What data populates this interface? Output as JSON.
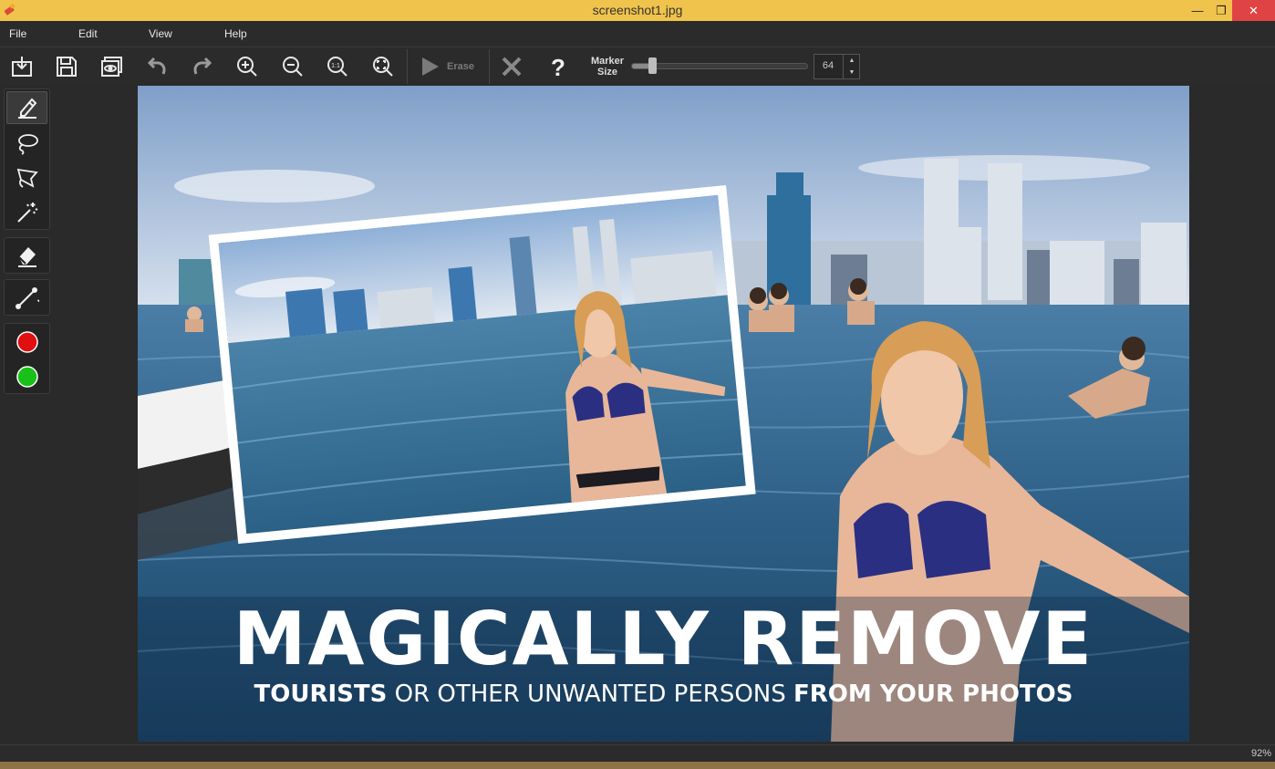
{
  "window": {
    "title": "screenshot1.jpg",
    "minimize_icon": "minimize-icon",
    "restore_icon": "restore-icon",
    "close_icon": "close-icon"
  },
  "menu": [
    "File",
    "Edit",
    "View",
    "Help"
  ],
  "toolbar": {
    "erase_label": "Erase",
    "marker_label_line1": "Marker",
    "marker_label_line2": "Size",
    "marker_size": "64",
    "marker_fraction": 0.12,
    "icons": [
      "open-icon",
      "save-icon",
      "preview-icon",
      "undo-icon",
      "redo-icon",
      "zoom-in-icon",
      "zoom-out-icon",
      "zoom-1to1-icon",
      "zoom-fit-icon",
      "play-icon",
      "cancel-icon",
      "help-icon"
    ]
  },
  "tools": {
    "marker": "marker-icon",
    "lasso": "lasso-icon",
    "polygon_lasso": "polygon-lasso-icon",
    "magic_wand": "magic-wand-icon",
    "eraser": "eraser-icon",
    "line": "line-icon",
    "colors": [
      "#e01010",
      "#18c018"
    ]
  },
  "image": {
    "headline": "MAGICALLY REMOVE",
    "subline_part1": "TOURISTS",
    "subline_part2": "OR OTHER UNWANTED PERSONS",
    "subline_part3": "FROM YOUR PHOTOS"
  },
  "status": {
    "zoom": "92%"
  }
}
